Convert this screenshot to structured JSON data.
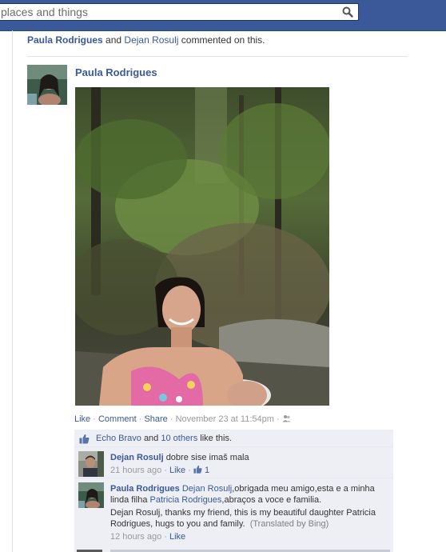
{
  "search": {
    "placeholder": "places and things"
  },
  "activity": {
    "user1": "Paula Rodrigues",
    "conj": "and",
    "user2": "Dejan Rosulj",
    "text": "commented on this."
  },
  "post": {
    "author": "Paula Rodrigues",
    "actions": {
      "like": "Like",
      "comment": "Comment",
      "share": "Share",
      "time": "November 23 at 11:54pm"
    }
  },
  "likes": {
    "name": "Echo Bravo",
    "and": "and",
    "others": "10 others",
    "suffix": "like this."
  },
  "comments": [
    {
      "author": "Dejan Rosulj",
      "text": "dobre sise imaš mala",
      "time": "21 hours ago",
      "like": "Like",
      "like_count": "1"
    },
    {
      "author": "Paula Rodrigues",
      "mention1": "Dejan Rosulj",
      "text1": ",obrigada meu amigo,esta e a minha linda filha ",
      "mention2": "Patricia Rodrigues",
      "text2": ",abraços a voce e familia.",
      "translation": "Dejan Rosulj, thanks my friend, this is my beautiful daughter Patricia Rodrigues, hugs to you and family.",
      "translated_by": "(Translated by Bing)",
      "time": "12 hours ago",
      "like": "Like"
    }
  ]
}
